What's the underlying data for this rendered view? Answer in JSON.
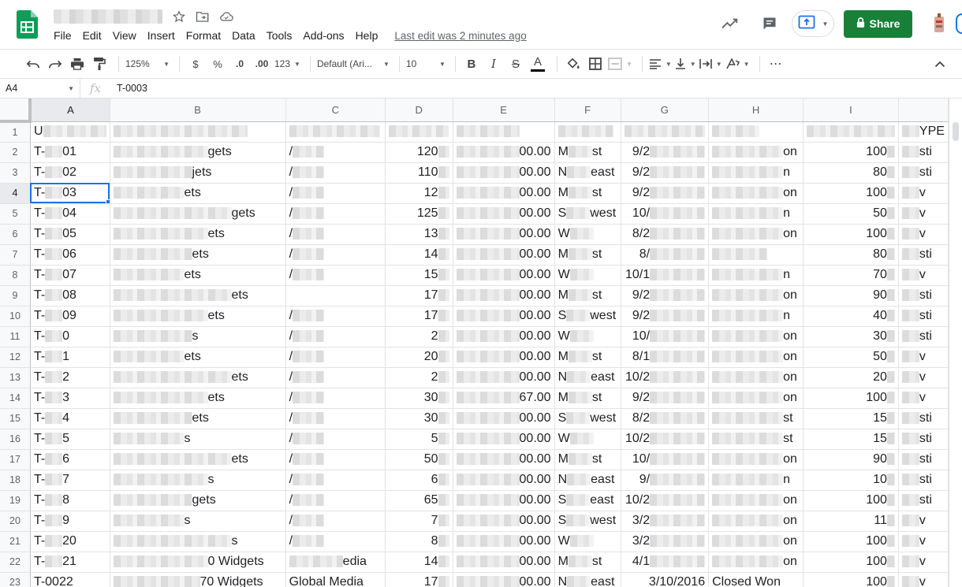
{
  "menu": [
    "File",
    "Edit",
    "View",
    "Insert",
    "Format",
    "Data",
    "Tools",
    "Add-ons",
    "Help"
  ],
  "last_edit": "Last edit was 2 minutes ago",
  "share_label": "Share",
  "toolbar": {
    "zoom": "125%",
    "currency": "$",
    "percent": "%",
    "decrease_decimals": ".0",
    "increase_decimals": ".00",
    "more_formats": "123",
    "font": "Default (Ari...",
    "font_size": "10",
    "bold": "B",
    "italic": "I",
    "strike": "S",
    "text_color": "A",
    "more": "⋯"
  },
  "formula_bar": {
    "cell_ref": "A4",
    "fx": "fx",
    "content": "T-0003"
  },
  "columns": [
    "A",
    "B",
    "C",
    "D",
    "E",
    "F",
    "G",
    "H",
    "I"
  ],
  "rows": [
    {
      "n": "1",
      "a": "U",
      "b": "",
      "c": "",
      "d": "",
      "e": "",
      "f": "",
      "g": "",
      "h": "",
      "i": "",
      "j": "YPE"
    },
    {
      "n": "2",
      "a": "T-",
      "b": "gets",
      "c": "/",
      "d": "120",
      "e": "00.00",
      "f1": "M",
      "f2": "st",
      "g": "9/2",
      "h": "on",
      "i": "100",
      "j": "sti"
    },
    {
      "n": "3",
      "a": "T-",
      "b": "jets",
      "c": "/",
      "d": "110",
      "e": "00.00",
      "f1": "N",
      "f2": "east",
      "g": "9/2",
      "h": "n",
      "i": "80",
      "j": "sti"
    },
    {
      "n": "4",
      "a": "T-",
      "b": "ets",
      "c": "/",
      "d": "12",
      "e": "00.00",
      "f1": "M",
      "f2": "st",
      "g": "9/2",
      "h": "on",
      "i": "100",
      "j": "v"
    },
    {
      "n": "5",
      "a": "T-",
      "b": "gets",
      "c": "/",
      "d": "125",
      "e": "00.00",
      "f1": "S",
      "f2": "west",
      "g": "10/",
      "h": "n",
      "i": "50",
      "j": "v"
    },
    {
      "n": "6",
      "a": "T-",
      "b": "ets",
      "c": "/",
      "d": "13",
      "e": "00.00",
      "f1": "W",
      "f2": "",
      "g": "8/2",
      "h": "on",
      "i": "100",
      "j": "v"
    },
    {
      "n": "7",
      "a": "T-",
      "b": "ets",
      "c": "/",
      "d": "14",
      "e": "00.00",
      "f1": "M",
      "f2": "st",
      "g": "8/",
      "h": "",
      "i": "80",
      "j": "sti"
    },
    {
      "n": "8",
      "a": "T-",
      "b": "ets",
      "c": "/",
      "d": "15",
      "e": "00.00",
      "f1": "W",
      "f2": "",
      "g": "10/1",
      "h": "n",
      "i": "70",
      "j": "v"
    },
    {
      "n": "9",
      "a": "T-",
      "b": "ets",
      "c": "",
      "d": "17",
      "e": "00.00",
      "f1": "M",
      "f2": "st",
      "g": "9/2",
      "h": "on",
      "i": "90",
      "j": "sti"
    },
    {
      "n": "10",
      "a": "T-",
      "b": "ets",
      "c": "/",
      "d": "17",
      "e": "00.00",
      "f1": "S",
      "f2": "west",
      "g": "9/2",
      "h": "n",
      "i": "40",
      "j": "sti"
    },
    {
      "n": "11",
      "a": "T-",
      "b": "s",
      "c": "/",
      "d": "2",
      "e": "00.00",
      "f1": "W",
      "f2": "",
      "g": "10/",
      "h": "on",
      "i": "30",
      "j": "sti"
    },
    {
      "n": "12",
      "a": "T-",
      "b": "ets",
      "c": "/",
      "d": "20",
      "e": "00.00",
      "f1": "M",
      "f2": "st",
      "g": "8/1",
      "h": "on",
      "i": "50",
      "j": "v"
    },
    {
      "n": "13",
      "a": "T-",
      "b": "ets",
      "c": "/",
      "d": "2",
      "e": "00.00",
      "f1": "N",
      "f2": "east",
      "g": "10/2",
      "h": "on",
      "i": "20",
      "j": "v"
    },
    {
      "n": "14",
      "a": "T-",
      "b": "ets",
      "c": "/",
      "d": "30",
      "e": "67.00",
      "f1": "M",
      "f2": "st",
      "g": "9/2",
      "h": "on",
      "i": "100",
      "j": "v"
    },
    {
      "n": "15",
      "a": "T-",
      "b": "ets",
      "c": "/",
      "d": "30",
      "e": "00.00",
      "f1": "S",
      "f2": "west",
      "g": "8/2",
      "h": "st",
      "i": "15",
      "j": "sti"
    },
    {
      "n": "16",
      "a": "T-",
      "b": "s",
      "c": "/",
      "d": "5",
      "e": "00.00",
      "f1": "W",
      "f2": "",
      "g": "10/2",
      "h": "st",
      "i": "15",
      "j": "sti"
    },
    {
      "n": "17",
      "a": "T-",
      "b": "ets",
      "c": "/",
      "d": "50",
      "e": "00.00",
      "f1": "M",
      "f2": "st",
      "g": "10/",
      "h": "on",
      "i": "90",
      "j": "sti"
    },
    {
      "n": "18",
      "a": "T-",
      "b": "s",
      "c": "/",
      "d": "6",
      "e": "00.00",
      "f1": "N",
      "f2": "east",
      "g": "9/",
      "h": "n",
      "i": "10",
      "j": "sti"
    },
    {
      "n": "19",
      "a": "T-",
      "b": "gets",
      "c": "/",
      "d": "65",
      "e": "00.00",
      "f1": "S",
      "f2": "east",
      "g": "10/2",
      "h": "on",
      "i": "100",
      "j": "sti"
    },
    {
      "n": "20",
      "a": "T-",
      "b": "s",
      "c": "/",
      "d": "7",
      "e": "00.00",
      "f1": "S",
      "f2": "west",
      "g": "3/2",
      "h": "on",
      "i": "11",
      "j": "v"
    },
    {
      "n": "21",
      "a": "T-",
      "b": "s",
      "c": "/",
      "d": "8",
      "e": "00.00",
      "f1": "W",
      "f2": "",
      "g": "3/2",
      "h": "on",
      "i": "100",
      "j": "v"
    },
    {
      "n": "22",
      "a": "T-",
      "b": "0 Widgets",
      "c": "edia",
      "d": "14",
      "e": "00.00",
      "f1": "M",
      "f2": "st",
      "g": "4/1",
      "h": "on",
      "i": "100",
      "j": "v"
    },
    {
      "n": "23",
      "a": "T-0022",
      "b": "70 Widgets",
      "c": "Global Media",
      "d": "17",
      "e": "00.00",
      "f1": "N",
      "f2": "east",
      "g": "3/10/2016",
      "h": "Closed Won",
      "i": "100",
      "j": "v"
    }
  ],
  "suffix_a": [
    "",
    "01",
    "02",
    "03",
    "04",
    "05",
    "06",
    "07",
    "08",
    "09",
    "0",
    "1",
    "2",
    "3",
    "4",
    "5",
    "6",
    "7",
    "8",
    "9",
    "20",
    "21",
    ""
  ]
}
